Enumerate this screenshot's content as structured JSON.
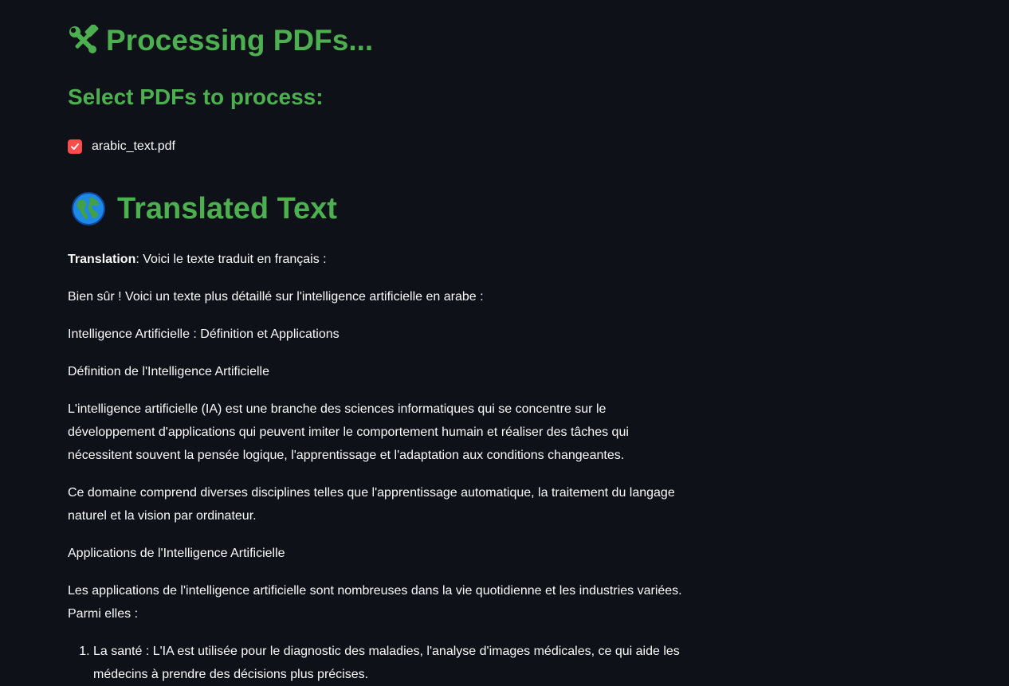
{
  "header": {
    "title": "Processing PDFs...",
    "title_icon": "hammer-and-wrench-icon"
  },
  "selection": {
    "heading": "Select PDFs to process:",
    "files": [
      {
        "label": "arabic_text.pdf",
        "checked": true
      }
    ]
  },
  "translation": {
    "heading": "Translated Text",
    "heading_icon": "globe-icon",
    "intro_label": "Translation",
    "intro_text": ": Voici le texte traduit en français :",
    "paragraphs": [
      "Bien sûr ! Voici un texte plus détaillé sur l'intelligence artificielle en arabe :",
      "Intelligence Artificielle : Définition et Applications",
      "Définition de l'Intelligence Artificielle",
      "L'intelligence artificielle (IA) est une branche des sciences informatiques qui se concentre sur le développement d'applications qui peuvent imiter le comportement humain et réaliser des tâches qui nécessitent souvent la pensée logique, l'apprentissage et l'adaptation aux conditions changeantes.",
      "Ce domaine comprend diverses disciplines telles que l'apprentissage automatique, la traitement du langage naturel et la vision par ordinateur.",
      "Applications de l'Intelligence Artificielle",
      "Les applications de l'intelligence artificielle sont nombreuses dans la vie quotidienne et les industries variées. Parmi elles :"
    ],
    "list_items": [
      "La santé : L'IA est utilisée pour le diagnostic des maladies, l'analyse d'images médicales, ce qui aide les médecins à prendre des décisions plus précises."
    ]
  },
  "colors": {
    "background": "#0e1117",
    "heading_green": "#4caf50",
    "text": "#fafafa",
    "checkbox_accent": "#ff4b4b"
  }
}
